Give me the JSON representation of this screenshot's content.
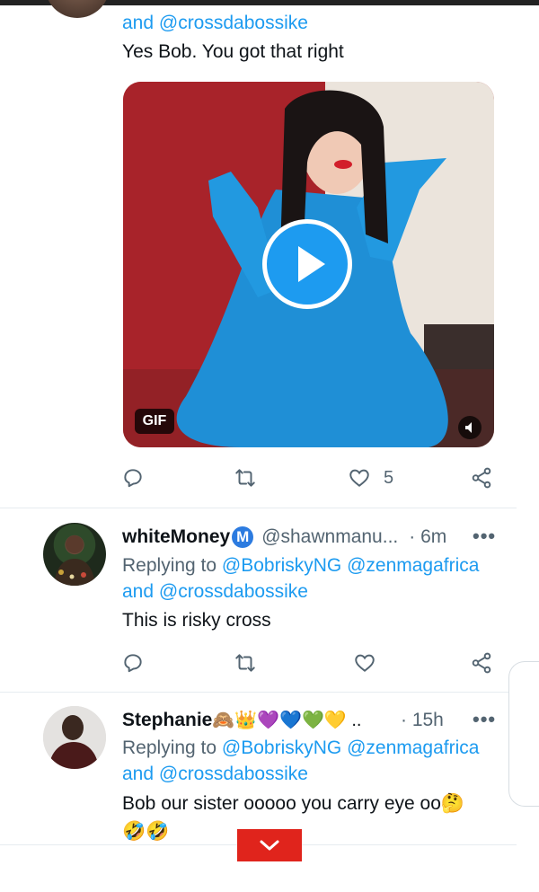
{
  "tweet1": {
    "mention_line": "and @crossdabossike",
    "body": "Yes Bob. You got that right",
    "media": {
      "badge": "GIF"
    },
    "likes": "5"
  },
  "tweet2": {
    "name": "whiteMoney",
    "handle": "@shawnmanu...",
    "time": "· 6m",
    "replying_to_label": "Replying to",
    "replying_to_users": "@BobriskyNG @zenmagafrica",
    "replying_to_line2": "and @crossdabossike",
    "body": "This is risky cross"
  },
  "tweet3": {
    "name": "Stephanie",
    "name_emoji": "🙈👑💜💙💚💛 ..",
    "time": "· 15h",
    "replying_to_label": "Replying to",
    "replying_to_users": "@BobriskyNG @zenmagafrica",
    "replying_to_line2": "and @crossdabossike",
    "body_line1": "Bob our sister ooooo you carry eye oo🤔",
    "body_line2": "🤣🤣"
  },
  "more_label": "•••",
  "colors": {
    "link": "#1d9bf0",
    "muted": "#536471",
    "scroll_button": "#e0241c"
  }
}
